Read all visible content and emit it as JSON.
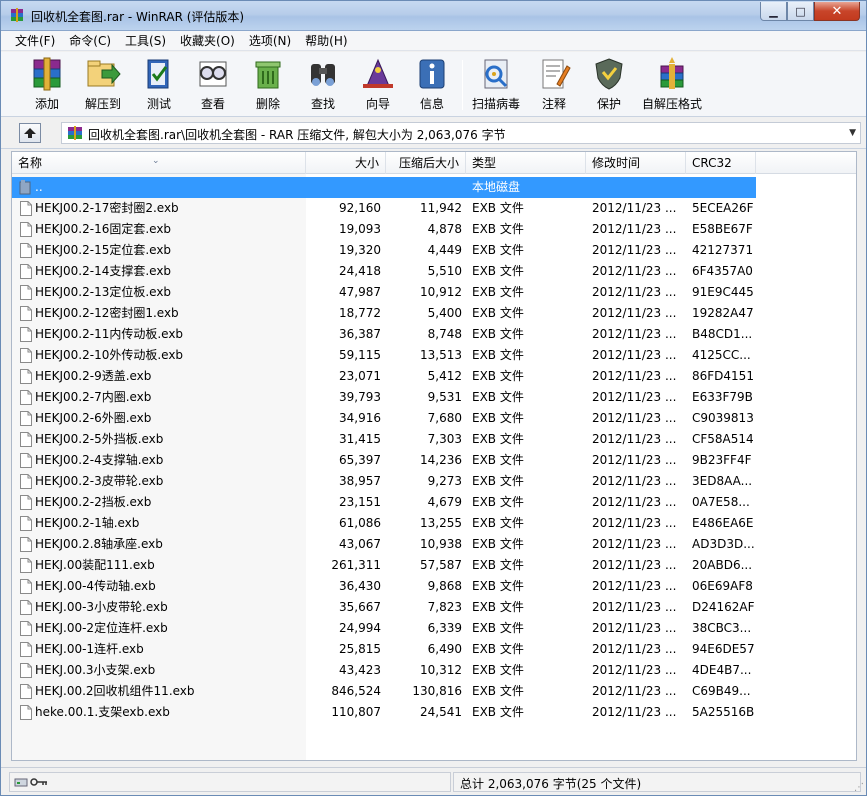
{
  "window": {
    "title": "回收机全套图.rar - WinRAR (评估版本)",
    "accent": "#3399ff"
  },
  "menu": [
    "文件(F)",
    "命令(C)",
    "工具(S)",
    "收藏夹(O)",
    "选项(N)",
    "帮助(H)"
  ],
  "toolbar": [
    {
      "label": "添加",
      "icon": "add-archive-icon"
    },
    {
      "label": "解压到",
      "icon": "extract-to-icon"
    },
    {
      "label": "测试",
      "icon": "test-icon"
    },
    {
      "label": "查看",
      "icon": "view-icon"
    },
    {
      "label": "删除",
      "icon": "delete-icon"
    },
    {
      "label": "查找",
      "icon": "find-icon"
    },
    {
      "label": "向导",
      "icon": "wizard-icon"
    },
    {
      "label": "信息",
      "icon": "info-icon"
    },
    {
      "label": "扫描病毒",
      "icon": "virus-scan-icon"
    },
    {
      "label": "注释",
      "icon": "comment-icon"
    },
    {
      "label": "保护",
      "icon": "protect-icon"
    },
    {
      "label": "自解压格式",
      "icon": "sfx-icon"
    }
  ],
  "address": {
    "path": "回收机全套图.rar\\回收机全套图 - RAR 压缩文件, 解包大小为 2,063,076 字节"
  },
  "columns": {
    "name": "名称",
    "size": "大小",
    "packed": "压缩后大小",
    "type": "类型",
    "mtime": "修改时间",
    "crc": "CRC32"
  },
  "parent_row": {
    "name": "..",
    "type": "本地磁盘"
  },
  "files": [
    {
      "name": "HEKJ00.2-17密封圈2.exb",
      "size": "92,160",
      "packed": "11,942",
      "type": "EXB 文件",
      "mtime": "2012/11/23 ...",
      "crc": "5ECEA26F"
    },
    {
      "name": "HEKJ00.2-16固定套.exb",
      "size": "19,093",
      "packed": "4,878",
      "type": "EXB 文件",
      "mtime": "2012/11/23 ...",
      "crc": "E58BE67F"
    },
    {
      "name": "HEKJ00.2-15定位套.exb",
      "size": "19,320",
      "packed": "4,449",
      "type": "EXB 文件",
      "mtime": "2012/11/23 ...",
      "crc": "42127371"
    },
    {
      "name": "HEKJ00.2-14支撑套.exb",
      "size": "24,418",
      "packed": "5,510",
      "type": "EXB 文件",
      "mtime": "2012/11/23 ...",
      "crc": "6F4357A0"
    },
    {
      "name": "HEKJ00.2-13定位板.exb",
      "size": "47,987",
      "packed": "10,912",
      "type": "EXB 文件",
      "mtime": "2012/11/23 ...",
      "crc": "91E9C445"
    },
    {
      "name": "HEKJ00.2-12密封圈1.exb",
      "size": "18,772",
      "packed": "5,400",
      "type": "EXB 文件",
      "mtime": "2012/11/23 ...",
      "crc": "19282A47"
    },
    {
      "name": "HEKJ00.2-11内传动板.exb",
      "size": "36,387",
      "packed": "8,748",
      "type": "EXB 文件",
      "mtime": "2012/11/23 ...",
      "crc": "B48CD1..."
    },
    {
      "name": "HEKJ00.2-10外传动板.exb",
      "size": "59,115",
      "packed": "13,513",
      "type": "EXB 文件",
      "mtime": "2012/11/23 ...",
      "crc": "4125CC..."
    },
    {
      "name": "HEKJ00.2-9透盖.exb",
      "size": "23,071",
      "packed": "5,412",
      "type": "EXB 文件",
      "mtime": "2012/11/23 ...",
      "crc": "86FD4151"
    },
    {
      "name": "HEKJ00.2-7内圈.exb",
      "size": "39,793",
      "packed": "9,531",
      "type": "EXB 文件",
      "mtime": "2012/11/23 ...",
      "crc": "E633F79B"
    },
    {
      "name": "HEKJ00.2-6外圈.exb",
      "size": "34,916",
      "packed": "7,680",
      "type": "EXB 文件",
      "mtime": "2012/11/23 ...",
      "crc": "C9039813"
    },
    {
      "name": "HEKJ00.2-5外挡板.exb",
      "size": "31,415",
      "packed": "7,303",
      "type": "EXB 文件",
      "mtime": "2012/11/23 ...",
      "crc": "CF58A514"
    },
    {
      "name": "HEKJ00.2-4支撑轴.exb",
      "size": "65,397",
      "packed": "14,236",
      "type": "EXB 文件",
      "mtime": "2012/11/23 ...",
      "crc": "9B23FF4F"
    },
    {
      "name": "HEKJ00.2-3皮带轮.exb",
      "size": "38,957",
      "packed": "9,273",
      "type": "EXB 文件",
      "mtime": "2012/11/23 ...",
      "crc": "3ED8AA..."
    },
    {
      "name": "HEKJ00.2-2挡板.exb",
      "size": "23,151",
      "packed": "4,679",
      "type": "EXB 文件",
      "mtime": "2012/11/23 ...",
      "crc": "0A7E58..."
    },
    {
      "name": "HEKJ00.2-1轴.exb",
      "size": "61,086",
      "packed": "13,255",
      "type": "EXB 文件",
      "mtime": "2012/11/23 ...",
      "crc": "E486EA6E"
    },
    {
      "name": "HEKJ00.2.8轴承座.exb",
      "size": "43,067",
      "packed": "10,938",
      "type": "EXB 文件",
      "mtime": "2012/11/23 ...",
      "crc": "AD3D3D..."
    },
    {
      "name": "HEKJ.00装配111.exb",
      "size": "261,311",
      "packed": "57,587",
      "type": "EXB 文件",
      "mtime": "2012/11/23 ...",
      "crc": "20ABD6..."
    },
    {
      "name": "HEKJ.00-4传动轴.exb",
      "size": "36,430",
      "packed": "9,868",
      "type": "EXB 文件",
      "mtime": "2012/11/23 ...",
      "crc": "06E69AF8"
    },
    {
      "name": "HEKJ.00-3小皮带轮.exb",
      "size": "35,667",
      "packed": "7,823",
      "type": "EXB 文件",
      "mtime": "2012/11/23 ...",
      "crc": "D24162AF"
    },
    {
      "name": "HEKJ.00-2定位连杆.exb",
      "size": "24,994",
      "packed": "6,339",
      "type": "EXB 文件",
      "mtime": "2012/11/23 ...",
      "crc": "38CBC3..."
    },
    {
      "name": "HEKJ.00-1连杆.exb",
      "size": "25,815",
      "packed": "6,490",
      "type": "EXB 文件",
      "mtime": "2012/11/23 ...",
      "crc": "94E6DE57"
    },
    {
      "name": "HEKJ.00.3小支架.exb",
      "size": "43,423",
      "packed": "10,312",
      "type": "EXB 文件",
      "mtime": "2012/11/23 ...",
      "crc": "4DE4B7..."
    },
    {
      "name": "HEKJ.00.2回收机组件11.exb",
      "size": "846,524",
      "packed": "130,816",
      "type": "EXB 文件",
      "mtime": "2012/11/23 ...",
      "crc": "C69B49..."
    },
    {
      "name": "heke.00.1.支架exb.exb",
      "size": "110,807",
      "packed": "24,541",
      "type": "EXB 文件",
      "mtime": "2012/11/23 ...",
      "crc": "5A25516B"
    }
  ],
  "status": {
    "right": "总计 2,063,076 字节(25 个文件)"
  }
}
